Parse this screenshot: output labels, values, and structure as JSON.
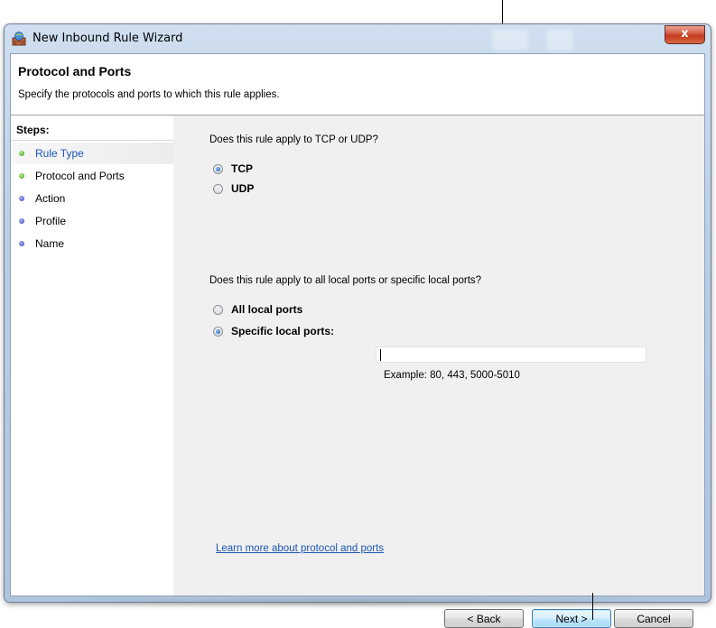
{
  "window": {
    "title": "New Inbound Rule Wizard",
    "close_label": "x"
  },
  "header": {
    "title": "Protocol and Ports",
    "subtitle": "Specify the protocols and ports to which this rule applies."
  },
  "steps": {
    "title": "Steps:",
    "items": [
      {
        "label": "Rule Type",
        "status": "done",
        "active": true
      },
      {
        "label": "Protocol and Ports",
        "status": "done",
        "active": false
      },
      {
        "label": "Action",
        "status": "pending",
        "active": false
      },
      {
        "label": "Profile",
        "status": "pending",
        "active": false
      },
      {
        "label": "Name",
        "status": "pending",
        "active": false
      }
    ]
  },
  "protocol": {
    "question": "Does this rule apply to TCP or UDP?",
    "options": [
      {
        "label": "TCP",
        "checked": true
      },
      {
        "label": "UDP",
        "checked": false
      }
    ]
  },
  "ports": {
    "question": "Does this rule apply to all local ports or specific local ports?",
    "options": [
      {
        "label": "All local ports",
        "checked": false
      },
      {
        "label": "Specific local ports:",
        "checked": true
      }
    ],
    "input_value": "",
    "example": "Example: 80, 443, 5000-5010"
  },
  "links": {
    "learn_more": "Learn more about protocol and ports"
  },
  "buttons": {
    "back": "< Back",
    "next": "Next >",
    "cancel": "Cancel"
  },
  "colors": {
    "link": "#1b56b3",
    "step_done": "#3a9a19",
    "step_pending": "#3a42b6",
    "close_button": "#c33a1d"
  }
}
